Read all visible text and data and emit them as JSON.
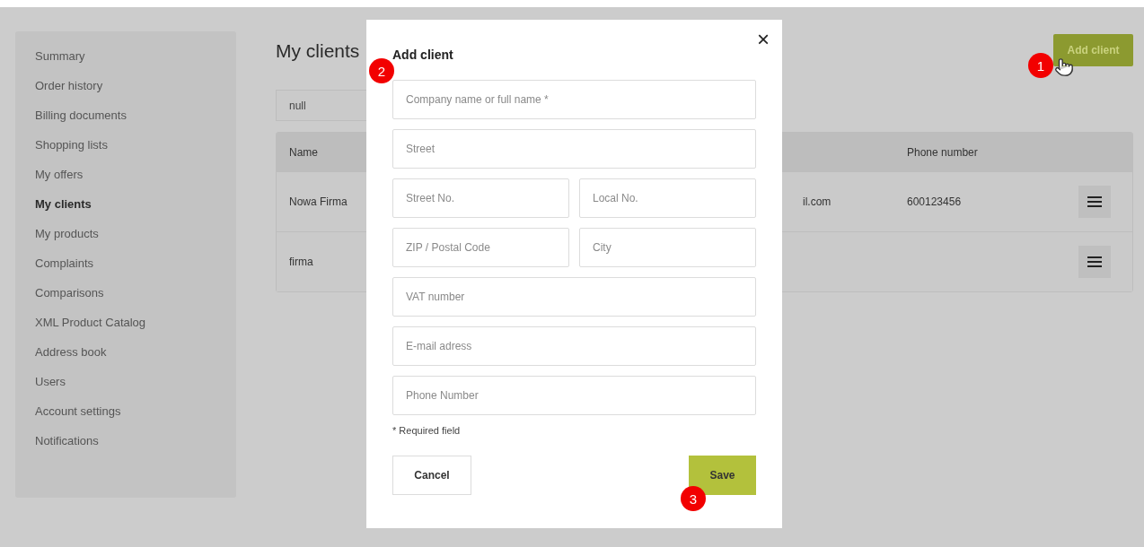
{
  "sidebar": {
    "items": [
      {
        "label": "Summary",
        "selected": false
      },
      {
        "label": "Order history",
        "selected": false
      },
      {
        "label": "Billing documents",
        "selected": false
      },
      {
        "label": "Shopping lists",
        "selected": false
      },
      {
        "label": "My offers",
        "selected": false
      },
      {
        "label": "My clients",
        "selected": true
      },
      {
        "label": "My products",
        "selected": false
      },
      {
        "label": "Complaints",
        "selected": false
      },
      {
        "label": "Comparisons",
        "selected": false
      },
      {
        "label": "XML Product Catalog",
        "selected": false
      },
      {
        "label": "Address book",
        "selected": false
      },
      {
        "label": "Users",
        "selected": false
      },
      {
        "label": "Account settings",
        "selected": false
      },
      {
        "label": "Notifications",
        "selected": false
      }
    ]
  },
  "main": {
    "title": "My clients",
    "add_button": "Add client",
    "search": {
      "value": "null"
    },
    "table": {
      "header": {
        "name": "Name",
        "phone": "Phone number"
      },
      "rows": [
        {
          "name": "Nowa Firma",
          "column_2": "il.com",
          "phone": "600123456"
        },
        {
          "name": "firma"
        }
      ]
    }
  },
  "dialog": {
    "title": "Add client",
    "close": "×",
    "rows": [
      {
        "fields": [
          {
            "placeholder": "Company name or full name *"
          }
        ]
      },
      {
        "fields": [
          {
            "placeholder": "Street"
          }
        ]
      },
      {
        "fields": [
          {
            "placeholder": "Street No."
          },
          {
            "placeholder": "Local No."
          }
        ]
      },
      {
        "fields": [
          {
            "placeholder": "ZIP / Postal Code"
          },
          {
            "placeholder": "City"
          }
        ]
      },
      {
        "fields": [
          {
            "placeholder": "VAT number"
          }
        ]
      },
      {
        "fields": [
          {
            "placeholder": "E-mail adress"
          }
        ]
      },
      {
        "fields": [
          {
            "placeholder": "Phone Number"
          }
        ]
      }
    ],
    "note": "* Required field",
    "cancel": "Cancel",
    "save": "Save"
  },
  "markers": [
    {
      "number": "1"
    },
    {
      "number": "2"
    },
    {
      "number": "3"
    }
  ]
}
